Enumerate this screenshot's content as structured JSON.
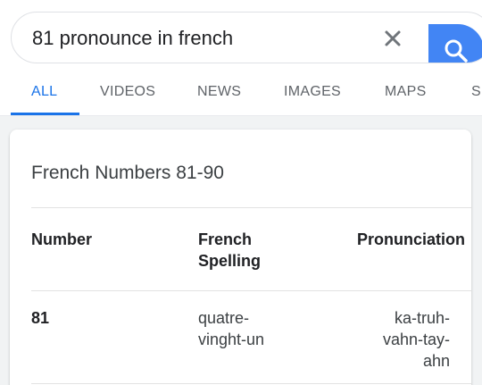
{
  "search": {
    "query": "81 pronounce in french",
    "clear_icon": "close-icon",
    "search_icon": "search-icon"
  },
  "tabs": [
    {
      "label": "ALL",
      "active": true
    },
    {
      "label": "VIDEOS",
      "active": false
    },
    {
      "label": "NEWS",
      "active": false
    },
    {
      "label": "IMAGES",
      "active": false
    },
    {
      "label": "MAPS",
      "active": false
    },
    {
      "label": "S",
      "active": false
    }
  ],
  "card": {
    "title": "French Numbers 81-90",
    "table": {
      "headers": [
        "Number",
        "French\nSpelling",
        "Pronunciation"
      ],
      "rows": [
        [
          "81",
          "quatre-\nvinght-un",
          "ka-truh-\nvahn-tay-\nahn"
        ]
      ]
    }
  },
  "colors": {
    "accent": "#1a73e8",
    "search_button": "#4285f4",
    "tab_inactive": "#5f6368"
  }
}
